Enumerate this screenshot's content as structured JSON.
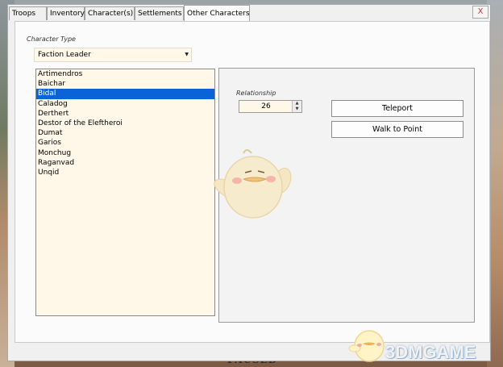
{
  "background": {
    "bottom_text": "PAUSED"
  },
  "tabs": [
    {
      "label": "Troops",
      "active": false
    },
    {
      "label": "Inventory",
      "active": false
    },
    {
      "label": "Character(s)",
      "active": false
    },
    {
      "label": "Settlements",
      "active": false
    },
    {
      "label": "Other Characters",
      "active": true
    }
  ],
  "window": {
    "close_label": "X"
  },
  "character_type": {
    "label": "Character Type",
    "value": "Faction Leader"
  },
  "characters": [
    "Artimendros",
    "Baichar",
    "Bidal",
    "Caladog",
    "Derthert",
    "Destor of the Eleftheroi",
    "Dumat",
    "Garios",
    "Monchug",
    "Raganvad",
    "Unqid"
  ],
  "selected_character": "Bidal",
  "relationship": {
    "label": "Relationship",
    "value": "26"
  },
  "actions": {
    "teleport": "Teleport",
    "walk_to_point": "Walk to Point"
  },
  "watermark": {
    "text": "3DMGAME"
  },
  "colors": {
    "selection": "#0a64d8",
    "field_bg": "#fff7e8",
    "close": "#c0392b"
  }
}
